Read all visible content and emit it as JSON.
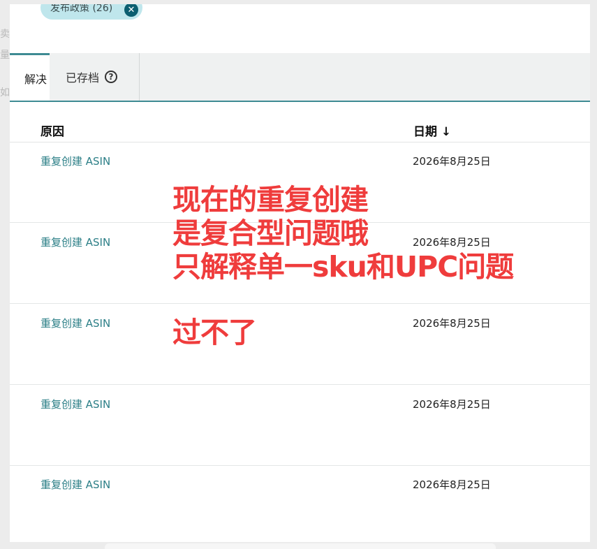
{
  "filter_chip": {
    "label": "发布政策 (26)",
    "close_icon": "close-circle-icon"
  },
  "tabs": {
    "unresolved_label": "解决",
    "archived_label": "已存档",
    "help_icon": "question-circle-icon"
  },
  "table": {
    "columns": {
      "reason": "原因",
      "date": "日期 ↓"
    },
    "rows": [
      {
        "reason": "重复创建 ASIN",
        "date": "2026年8月25日"
      },
      {
        "reason": "重复创建 ASIN",
        "date": "2026年8月25日"
      },
      {
        "reason": "重复创建 ASIN",
        "date": "2026年8月25日"
      },
      {
        "reason": "重复创建 ASIN",
        "date": "2026年8月25日"
      },
      {
        "reason": "重复创建 ASIN",
        "date": "2026年8月25日"
      }
    ]
  },
  "annotation": {
    "line1": "现在的重复创建",
    "line2": "是复合型问题哦",
    "line3": "只解释单一sku和UPC问题",
    "line4": "过不了",
    "color": "#ef3c3c"
  },
  "accent_color": "#3e8b93",
  "link_color": "#2c7f87"
}
